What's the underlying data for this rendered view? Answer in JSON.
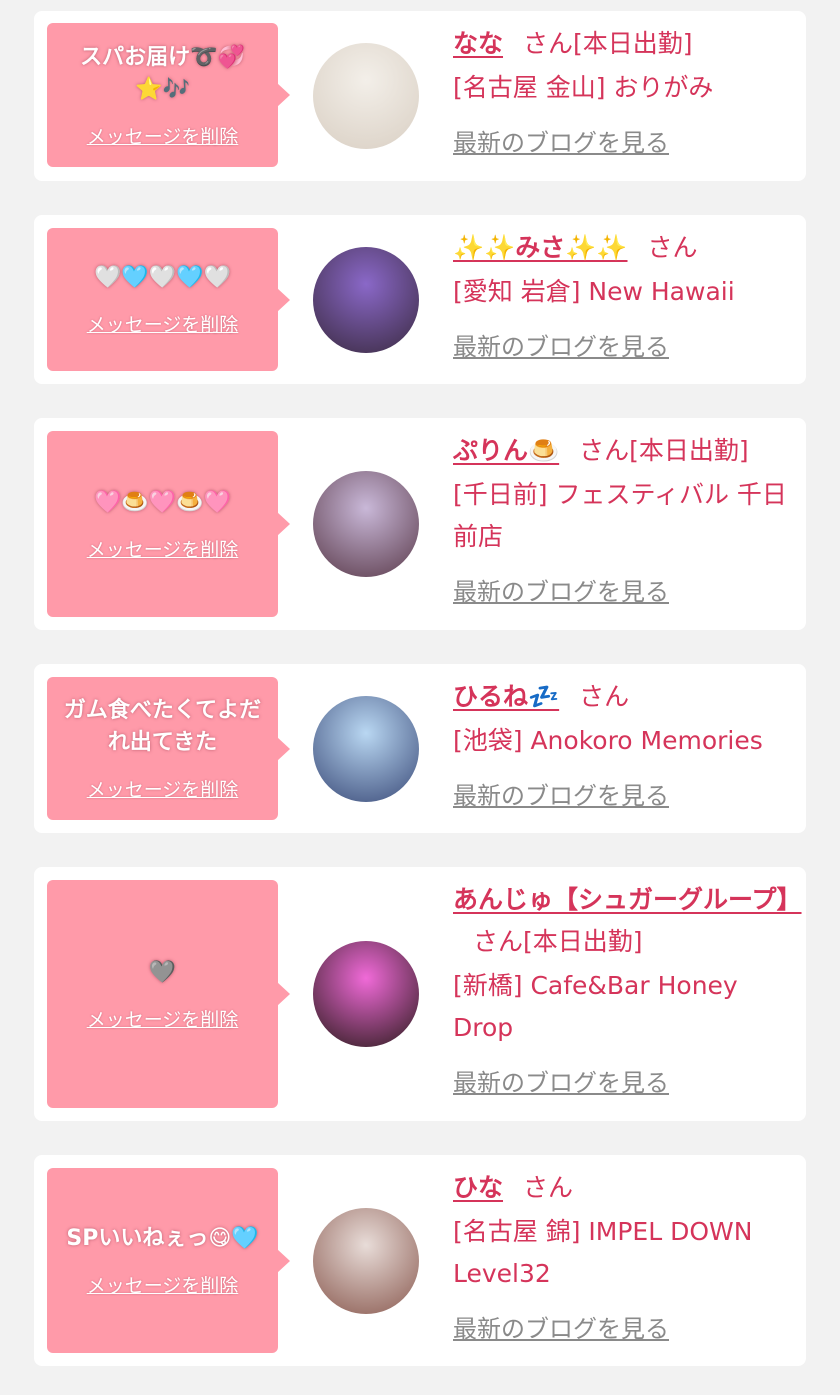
{
  "cards": [
    {
      "message": "スパお届け➰💞⭐🎶",
      "delete_label": "メッセージを削除",
      "name": "なな",
      "honorific": "さん",
      "status": "[本日出勤]",
      "shop": "[名古屋 金山] おりがみ",
      "blog_label": "最新のブログを見る",
      "avatar_colors": [
        "#f3efe9",
        "#d9cfc3"
      ]
    },
    {
      "message": "🤍🩵🤍🩵🤍",
      "delete_label": "メッセージを削除",
      "name": "✨✨みさ✨✨",
      "honorific": "さん",
      "status": "",
      "shop": "[愛知 岩倉] New Hawaii",
      "blog_label": "最新のブログを見る",
      "avatar_colors": [
        "#8a68c8",
        "#3a2a40"
      ]
    },
    {
      "message": "🩷🍮🩷🍮🩷",
      "delete_label": "メッセージを削除",
      "name": "ぷりん🍮",
      "honorific": "さん",
      "status": "[本日出勤]",
      "shop": "[千日前] フェスティバル 千日前店",
      "blog_label": "最新のブログを見る",
      "avatar_colors": [
        "#c9b8d8",
        "#5a3a4a"
      ]
    },
    {
      "message": "ガム食べたくてよだれ出てきた",
      "delete_label": "メッセージを削除",
      "name": "ひるね💤",
      "honorific": "さん",
      "status": "",
      "shop": "[池袋] Anokoro Memories",
      "blog_label": "最新のブログを見る",
      "avatar_colors": [
        "#b9d7f2",
        "#3a4a78"
      ]
    },
    {
      "message": "🩶",
      "delete_label": "メッセージを削除",
      "name": "あんじゅ【シュガーグループ】",
      "honorific": "さん",
      "status": "[本日出勤]",
      "shop": "[新橋] Cafe&Bar Honey Drop",
      "blog_label": "最新のブログを見る",
      "avatar_colors": [
        "#f06ad8",
        "#2a1a1a"
      ]
    },
    {
      "message": "SPいいねぇっ😋🩵",
      "delete_label": "メッセージを削除",
      "name": "ひな",
      "honorific": "さん",
      "status": "",
      "shop": "[名古屋 錦] IMPEL DOWN Level32",
      "blog_label": "最新のブログを見る",
      "avatar_colors": [
        "#e8dcd8",
        "#8a5a50"
      ]
    }
  ]
}
